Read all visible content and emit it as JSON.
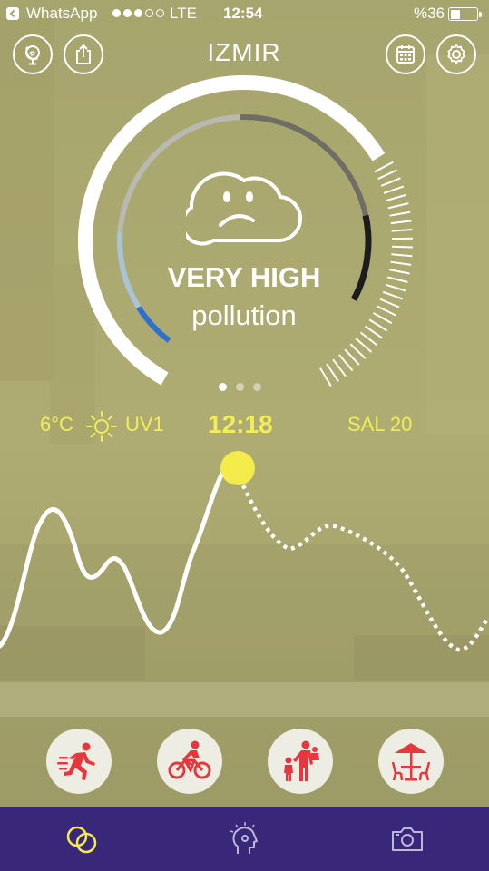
{
  "status_bar": {
    "carrier": "WhatsApp",
    "signal_bars_filled": 3,
    "signal_bars_total": 5,
    "network": "LTE",
    "time": "12:54",
    "battery_percent": "%36",
    "battery_level": 0.36
  },
  "header": {
    "city": "IZMIR",
    "left_buttons": [
      "globe-icon",
      "share-icon"
    ],
    "right_buttons": [
      "calendar-icon",
      "gear-icon"
    ]
  },
  "gauge": {
    "level": "VERY HIGH",
    "label": "pollution",
    "face_icon": "sad-cloud-icon",
    "pages": 3,
    "active_page": 0
  },
  "conditions": {
    "temperature": "6°C",
    "weather_icon": "sun-icon",
    "uv": "UV1",
    "selected_time": "12:18",
    "sal": "SAL 20"
  },
  "activities": [
    {
      "name": "running",
      "icon": "running-icon"
    },
    {
      "name": "cycling",
      "icon": "cycling-icon"
    },
    {
      "name": "family",
      "icon": "family-icon"
    },
    {
      "name": "outdoor-dining",
      "icon": "cafe-table-icon"
    }
  ],
  "bottom_nav": [
    {
      "name": "overview",
      "icon": "overlapping-circles-icon",
      "active": true
    },
    {
      "name": "health",
      "icon": "head-sensor-icon",
      "active": false
    },
    {
      "name": "camera",
      "icon": "camera-icon",
      "active": false
    }
  ],
  "colors": {
    "accent_yellow": "#f4ec4c",
    "nav_purple": "#39287a",
    "activity_red": "#e6373e",
    "gauge_blue": "#2f6fd0"
  }
}
